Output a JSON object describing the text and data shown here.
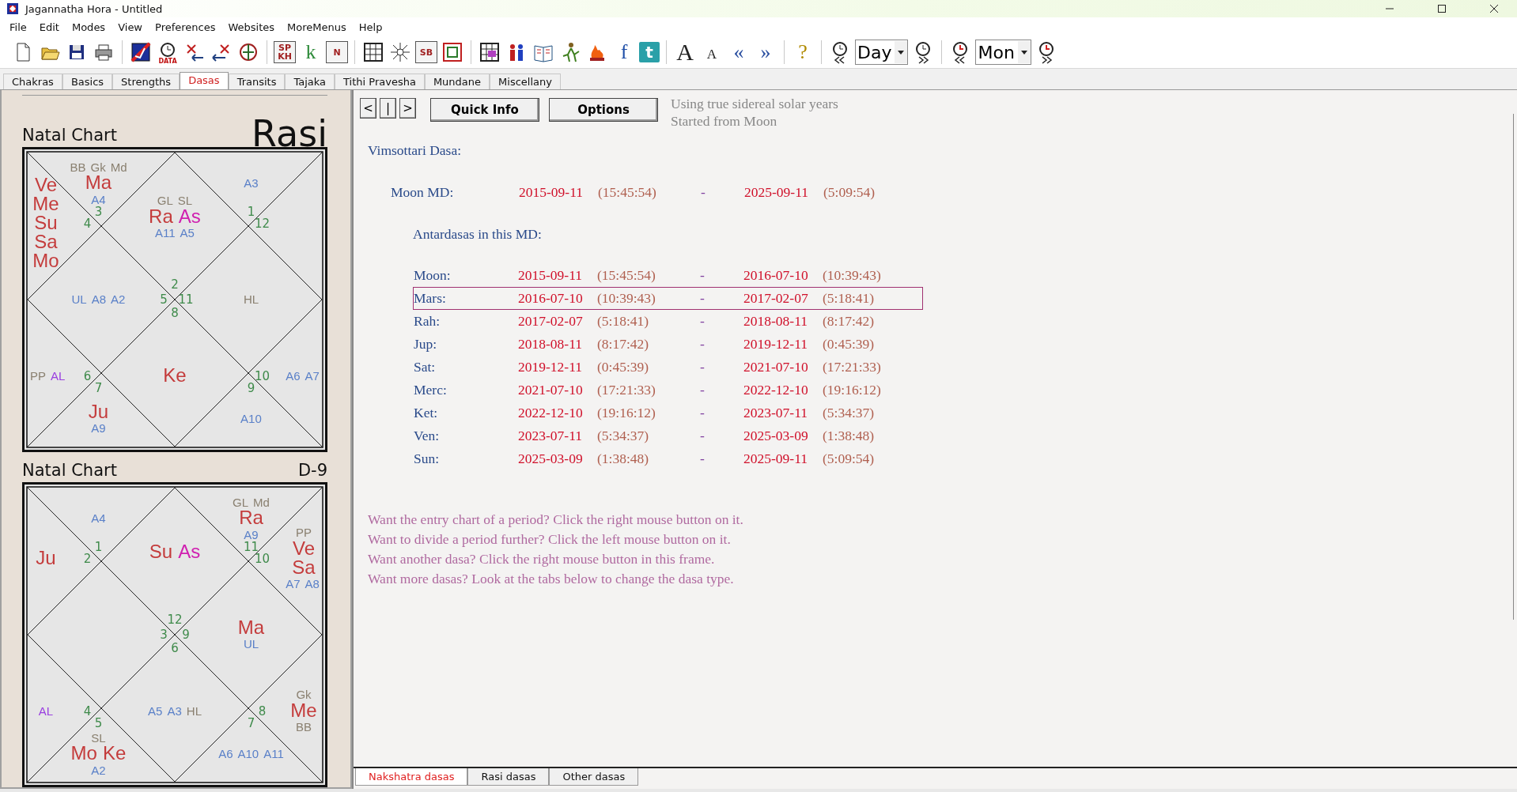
{
  "window": {
    "title": "Jagannatha Hora - Untitled"
  },
  "menu": [
    "File",
    "Edit",
    "Modes",
    "View",
    "Preferences",
    "Websites",
    "MoreMenus",
    "Help"
  ],
  "toolbar": [
    {
      "kind": "icon"
    },
    {
      "kind": "icon"
    },
    {
      "kind": "icon"
    },
    {
      "kind": "icon"
    },
    {
      "kind": "separator"
    },
    {
      "kind": "icon"
    },
    {
      "kind": "labeled",
      "text": "DATA"
    },
    {
      "kind": "icon"
    },
    {
      "kind": "icon"
    },
    {
      "kind": "icon"
    },
    {
      "kind": "separator"
    },
    {
      "kind": "boxed",
      "text": "SP KH"
    },
    {
      "kind": "letter",
      "text": "k",
      "color": "#2e8b3a"
    },
    {
      "kind": "boxed",
      "text": "N"
    },
    {
      "kind": "separator"
    },
    {
      "kind": "icon"
    },
    {
      "kind": "icon"
    },
    {
      "kind": "boxed",
      "text": "SB"
    },
    {
      "kind": "icon"
    },
    {
      "kind": "separator"
    },
    {
      "kind": "icon"
    },
    {
      "kind": "icon"
    },
    {
      "kind": "icon"
    },
    {
      "kind": "icon"
    },
    {
      "kind": "icon"
    },
    {
      "kind": "letter",
      "text": "f",
      "color": "#1f4fa8"
    },
    {
      "kind": "tile",
      "text": "t"
    },
    {
      "kind": "separator"
    },
    {
      "kind": "letter-large",
      "text": "A",
      "color": "#222222"
    },
    {
      "kind": "letter-small",
      "text": "A",
      "color": "#222222"
    },
    {
      "kind": "letter",
      "text": "«",
      "color": "#2a4fa0"
    },
    {
      "kind": "letter",
      "text": "»",
      "color": "#2a4fa0"
    },
    {
      "kind": "separator"
    },
    {
      "kind": "letter",
      "text": "?",
      "color": "#b08a00"
    },
    {
      "kind": "separator"
    },
    {
      "kind": "icon"
    },
    {
      "kind": "dropdown",
      "value": "Day"
    },
    {
      "kind": "icon"
    },
    {
      "kind": "separator"
    },
    {
      "kind": "icon"
    },
    {
      "kind": "dropdown",
      "value": "Mon"
    },
    {
      "kind": "icon"
    }
  ],
  "tabs": [
    {
      "label": "Chakras",
      "selected": false
    },
    {
      "label": "Basics",
      "selected": false
    },
    {
      "label": "Strengths",
      "selected": false
    },
    {
      "label": "Dasas",
      "selected": true
    },
    {
      "label": "Transits",
      "selected": false
    },
    {
      "label": "Tajaka",
      "selected": false
    },
    {
      "label": "Tithi Pravesha",
      "selected": false
    },
    {
      "label": "Mundane",
      "selected": false
    },
    {
      "label": "Miscellany",
      "selected": false
    }
  ],
  "charts": [
    {
      "title": "Natal Chart",
      "varga": "Rasi",
      "kind": "main",
      "houses": [
        {
          "sign": "2",
          "items": [
            {
              "text": "GL",
              "kind": "special"
            },
            {
              "text": "SL",
              "kind": "special"
            },
            {
              "text": "Ra",
              "kind": "planet"
            },
            {
              "text": "As",
              "kind": "lagna"
            },
            {
              "text": "A11",
              "kind": "arudha"
            },
            {
              "text": "A5",
              "kind": "arudha"
            }
          ]
        },
        {
          "sign": "3",
          "items": [
            {
              "text": "BB",
              "kind": "special"
            },
            {
              "text": "Gk",
              "kind": "special"
            },
            {
              "text": "Md",
              "kind": "special"
            },
            {
              "text": "Ma",
              "kind": "planet"
            },
            {
              "text": "A4",
              "kind": "arudha"
            }
          ]
        },
        {
          "sign": "4",
          "items": [
            {
              "text": "Ve",
              "kind": "planet"
            },
            {
              "text": "Me",
              "kind": "planet"
            },
            {
              "text": "Su",
              "kind": "planet"
            },
            {
              "text": "Sa",
              "kind": "planet"
            },
            {
              "text": "Mo",
              "kind": "planet"
            }
          ]
        },
        {
          "sign": "5",
          "items": [
            {
              "text": "UL",
              "kind": "arudha"
            },
            {
              "text": "A8",
              "kind": "arudha"
            },
            {
              "text": "A2",
              "kind": "arudha"
            }
          ]
        },
        {
          "sign": "6",
          "items": [
            {
              "text": "PP",
              "kind": "special"
            },
            {
              "text": "AL",
              "kind": "arudha-lagna"
            }
          ]
        },
        {
          "sign": "7",
          "items": [
            {
              "text": "Ju",
              "kind": "planet"
            },
            {
              "text": "A9",
              "kind": "arudha"
            }
          ]
        },
        {
          "sign": "8",
          "items": [
            {
              "text": "Ke",
              "kind": "planet"
            }
          ]
        },
        {
          "sign": "9",
          "items": [
            {
              "text": "A10",
              "kind": "arudha"
            }
          ]
        },
        {
          "sign": "10",
          "items": [
            {
              "text": "A6",
              "kind": "arudha"
            },
            {
              "text": "A7",
              "kind": "arudha"
            }
          ]
        },
        {
          "sign": "11",
          "items": [
            {
              "text": "HL",
              "kind": "special"
            }
          ]
        },
        {
          "sign": "12"
        },
        {
          "sign": "1",
          "items": [
            {
              "text": "A3",
              "kind": "arudha"
            }
          ]
        }
      ]
    },
    {
      "title": "Natal Chart",
      "varga": "D-9",
      "kind": "divisional",
      "houses": [
        {
          "sign": "12",
          "items": [
            {
              "text": "Su",
              "kind": "planet"
            },
            {
              "text": "As",
              "kind": "lagna"
            }
          ]
        },
        {
          "sign": "1",
          "items": [
            {
              "text": "A4",
              "kind": "arudha"
            }
          ]
        },
        {
          "sign": "2",
          "items": [
            {
              "text": "Ju",
              "kind": "planet"
            }
          ]
        },
        {
          "sign": "3"
        },
        {
          "sign": "4",
          "items": [
            {
              "text": "AL",
              "kind": "arudha-lagna"
            }
          ]
        },
        {
          "sign": "5",
          "items": [
            {
              "text": "SL",
              "kind": "special"
            },
            {
              "text": "Mo",
              "kind": "planet"
            },
            {
              "text": "Ke",
              "kind": "planet"
            },
            {
              "text": "A2",
              "kind": "arudha"
            }
          ]
        },
        {
          "sign": "6",
          "items": [
            {
              "text": "A5",
              "kind": "arudha"
            },
            {
              "text": "A3",
              "kind": "arudha"
            },
            {
              "text": "HL",
              "kind": "special"
            }
          ]
        },
        {
          "sign": "7",
          "items": [
            {
              "text": "A6",
              "kind": "arudha"
            },
            {
              "text": "A10",
              "kind": "arudha"
            },
            {
              "text": "A11",
              "kind": "arudha"
            }
          ]
        },
        {
          "sign": "8",
          "items": [
            {
              "text": "Gk",
              "kind": "special"
            },
            {
              "text": "Me",
              "kind": "planet"
            },
            {
              "text": "BB",
              "kind": "special"
            }
          ]
        },
        {
          "sign": "9",
          "items": [
            {
              "text": "Ma",
              "kind": "planet"
            },
            {
              "text": "UL",
              "kind": "arudha"
            }
          ]
        },
        {
          "sign": "10",
          "items": [
            {
              "text": "PP",
              "kind": "special"
            },
            {
              "text": "Ve",
              "kind": "planet"
            },
            {
              "text": "Sa",
              "kind": "planet"
            },
            {
              "text": "A7",
              "kind": "arudha"
            },
            {
              "text": "A8",
              "kind": "arudha"
            }
          ]
        },
        {
          "sign": "11",
          "items": [
            {
              "text": "GL",
              "kind": "special"
            },
            {
              "text": "Md",
              "kind": "special"
            },
            {
              "text": "Ra",
              "kind": "planet"
            },
            {
              "text": "A9",
              "kind": "arudha"
            }
          ]
        }
      ]
    }
  ],
  "dasa": {
    "nav": [
      "<",
      "|",
      ">"
    ],
    "buttons": [
      "Quick Info",
      "Options"
    ],
    "notes": [
      "Using true sidereal solar years",
      "Started from Moon"
    ],
    "heading": "Vimsottari Dasa:",
    "md": {
      "name": "Moon MD:",
      "start_date": "2015-09-11",
      "start_time": "(15:45:54)",
      "sep": "-",
      "end_date": "2025-09-11",
      "end_time": "(5:09:54)"
    },
    "sub_heading": "Antardasas in this MD:",
    "rows": [
      {
        "name": "Moon:",
        "start_date": "2015-09-11",
        "start_time": "(15:45:54)",
        "sep": "-",
        "end_date": "2016-07-10",
        "end_time": "(10:39:43)",
        "selected": false
      },
      {
        "name": "Mars:",
        "start_date": "2016-07-10",
        "start_time": "(10:39:43)",
        "sep": "-",
        "end_date": "2017-02-07",
        "end_time": "(5:18:41)",
        "selected": true
      },
      {
        "name": "Rah:",
        "start_date": "2017-02-07",
        "start_time": "(5:18:41)",
        "sep": "-",
        "end_date": "2018-08-11",
        "end_time": "(8:17:42)",
        "selected": false
      },
      {
        "name": "Jup:",
        "start_date": "2018-08-11",
        "start_time": "(8:17:42)",
        "sep": "-",
        "end_date": "2019-12-11",
        "end_time": "(0:45:39)",
        "selected": false
      },
      {
        "name": "Sat:",
        "start_date": "2019-12-11",
        "start_time": "(0:45:39)",
        "sep": "-",
        "end_date": "2021-07-10",
        "end_time": "(17:21:33)",
        "selected": false
      },
      {
        "name": "Merc:",
        "start_date": "2021-07-10",
        "start_time": "(17:21:33)",
        "sep": "-",
        "end_date": "2022-12-10",
        "end_time": "(19:16:12)",
        "selected": false
      },
      {
        "name": "Ket:",
        "start_date": "2022-12-10",
        "start_time": "(19:16:12)",
        "sep": "-",
        "end_date": "2023-07-11",
        "end_time": "(5:34:37)",
        "selected": false
      },
      {
        "name": "Ven:",
        "start_date": "2023-07-11",
        "start_time": "(5:34:37)",
        "sep": "-",
        "end_date": "2025-03-09",
        "end_time": "(1:38:48)",
        "selected": false
      },
      {
        "name": "Sun:",
        "start_date": "2025-03-09",
        "start_time": "(1:38:48)",
        "sep": "-",
        "end_date": "2025-09-11",
        "end_time": "(5:09:54)",
        "selected": false
      }
    ],
    "hints": [
      "Want the entry chart of a period? Click the right mouse button on it.",
      "Want to divide a period further? Click the left mouse button on it.",
      "Want another dasa? Click the right mouse button in this frame.",
      "Want more dasas? Look at the tabs below to change the dasa type."
    ]
  },
  "dasa_tabs": [
    {
      "label": "Nakshatra dasas",
      "selected": true
    },
    {
      "label": "Rasi dasas",
      "selected": false
    },
    {
      "label": "Other dasas",
      "selected": false
    }
  ]
}
